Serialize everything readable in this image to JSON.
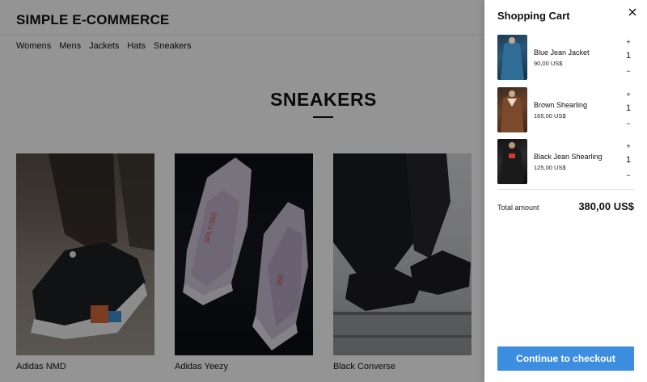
{
  "header": {
    "brand": "SIMPLE E-COMMERCE",
    "nav": [
      "Womens",
      "Mens",
      "Jackets",
      "Hats",
      "Sneakers"
    ]
  },
  "main": {
    "title": "SNEAKERS",
    "products": [
      {
        "name": "Adidas NMD"
      },
      {
        "name": "Adidas Yeezy"
      },
      {
        "name": "Black Converse"
      }
    ]
  },
  "cart": {
    "title": "Shopping Cart",
    "close_icon": "close-icon",
    "items": [
      {
        "name": "Blue Jean Jacket",
        "price": "90,00 US$",
        "qty": "1",
        "plus": "+",
        "minus": "−"
      },
      {
        "name": "Brown Shearling",
        "price": "165,00 US$",
        "qty": "1",
        "plus": "+",
        "minus": "−"
      },
      {
        "name": "Black Jean Shearling",
        "price": "125,00 US$",
        "qty": "1",
        "plus": "+",
        "minus": "−"
      }
    ],
    "total_label": "Total amount",
    "total_value": "380,00 US$",
    "checkout_label": "Continue to checkout"
  },
  "colors": {
    "accent": "#3d8ee0",
    "overlay": "rgba(0,0,0,0.42)"
  }
}
